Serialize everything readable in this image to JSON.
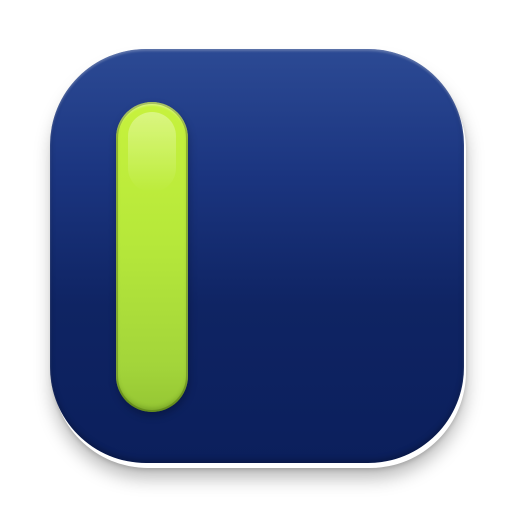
{
  "icon": {
    "name": "app-icon",
    "tile_colors": {
      "top": "#2c4a94",
      "bottom": "#0b1f5c"
    },
    "bar_colors": {
      "top": "#c7f23d",
      "bottom": "#95c634"
    }
  }
}
